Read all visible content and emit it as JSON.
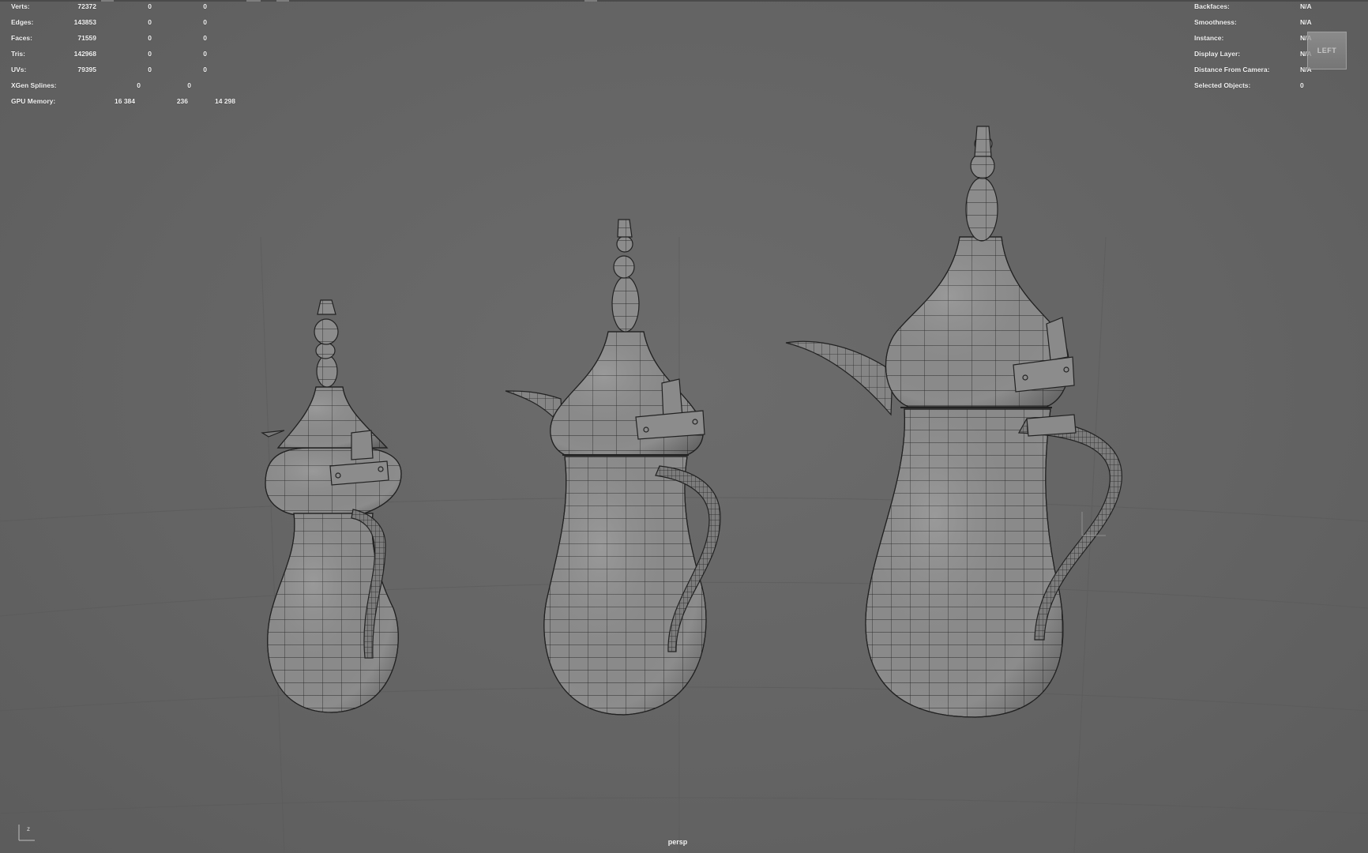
{
  "hud_left": {
    "rows": [
      {
        "label": "Verts:",
        "c1": "72372",
        "c2": "0",
        "c3": "0"
      },
      {
        "label": "Edges:",
        "c1": "143853",
        "c2": "0",
        "c3": "0"
      },
      {
        "label": "Faces:",
        "c1": "71559",
        "c2": "0",
        "c3": "0"
      },
      {
        "label": "Tris:",
        "c1": "142968",
        "c2": "0",
        "c3": "0"
      },
      {
        "label": "UVs:",
        "c1": "79395",
        "c2": "0",
        "c3": "0"
      },
      {
        "label": "XGen Splines:",
        "c1": "",
        "c2": "0",
        "c3": "0"
      },
      {
        "label": "GPU Memory:",
        "c1": "16 384",
        "c2": "236",
        "c3": "14 298"
      }
    ]
  },
  "hud_right": {
    "rows": [
      {
        "label": "Backfaces:",
        "value": "N/A"
      },
      {
        "label": "Smoothness:",
        "value": "N/A"
      },
      {
        "label": "Instance:",
        "value": "N/A"
      },
      {
        "label": "Display Layer:",
        "value": "N/A"
      },
      {
        "label": "Distance From Camera:",
        "value": "N/A"
      },
      {
        "label": "Selected Objects:",
        "value": "0"
      }
    ]
  },
  "viewcube": {
    "face_label": "LEFT"
  },
  "camera_label": "persp",
  "axis_indicator": {
    "label": "z"
  },
  "scene": {
    "objects": [
      "dallah-small",
      "dallah-medium",
      "dallah-large"
    ]
  },
  "colors": {
    "background": "#666666",
    "mesh_fill": "#8a8a8a",
    "wire": "#2a2a2a",
    "hud_text": "#f4f4f4"
  }
}
